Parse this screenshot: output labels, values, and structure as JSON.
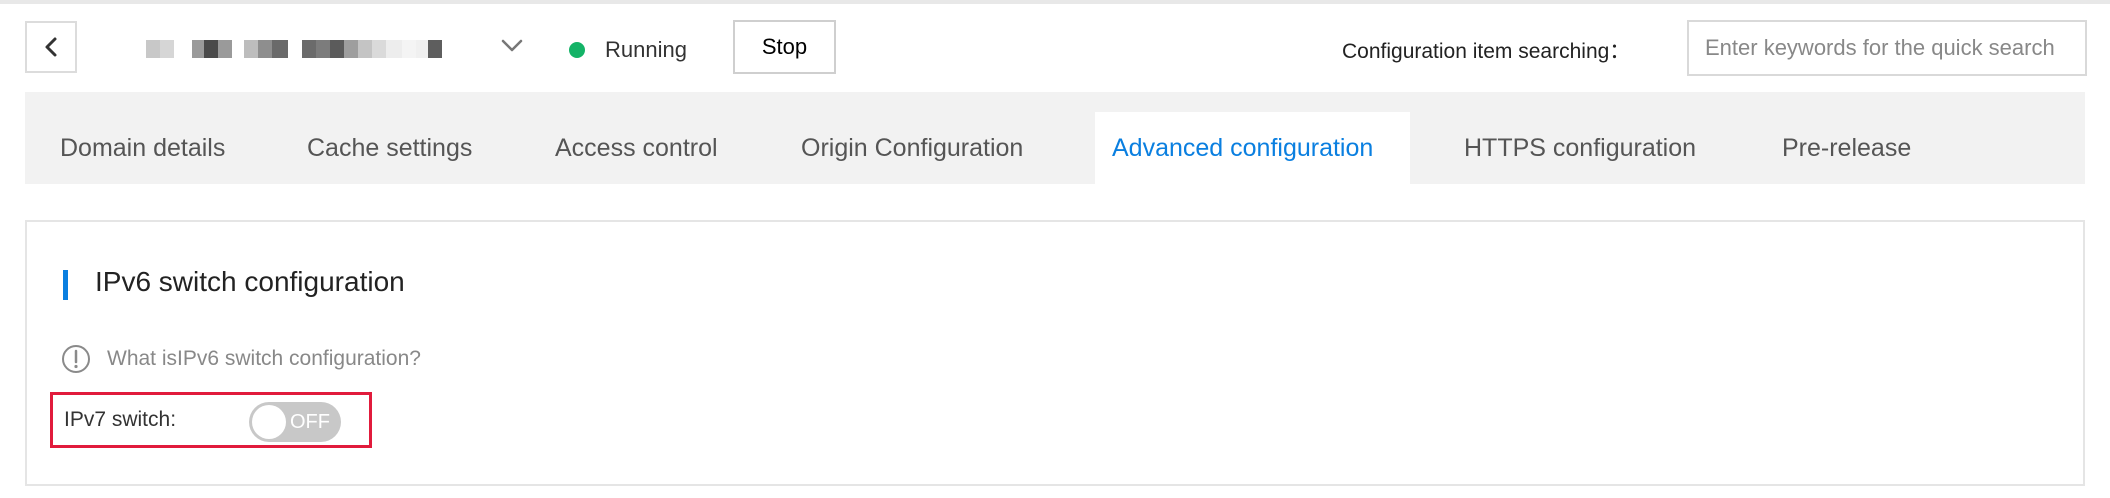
{
  "header": {
    "back_icon": "chevron-left-icon",
    "domain_dropdown_icon": "chevron-down-icon",
    "status": {
      "text": "Running",
      "color": "#14b367"
    },
    "stop_label": "Stop",
    "search": {
      "label": "Configuration item searching：",
      "placeholder": "Enter keywords for the quick search"
    }
  },
  "tabs": [
    {
      "label": "Domain details",
      "active": false
    },
    {
      "label": "Cache settings",
      "active": false
    },
    {
      "label": "Access control",
      "active": false
    },
    {
      "label": "Origin Configuration",
      "active": false
    },
    {
      "label": "Advanced configuration",
      "active": true
    },
    {
      "label": "HTTPS configuration",
      "active": false
    },
    {
      "label": "Pre-release",
      "active": false
    }
  ],
  "section": {
    "title": "IPv6 switch configuration",
    "help_icon": "exclamation-circle-icon",
    "help_link": "What isIPv6 switch configuration?",
    "switch": {
      "label": "IPv7 switch:",
      "state_text": "OFF",
      "on": false
    }
  },
  "colors": {
    "accent": "#0a7fe0",
    "highlight": "#e11b3c",
    "status_running": "#14b367",
    "toggle_off": "#c8c8c8"
  }
}
